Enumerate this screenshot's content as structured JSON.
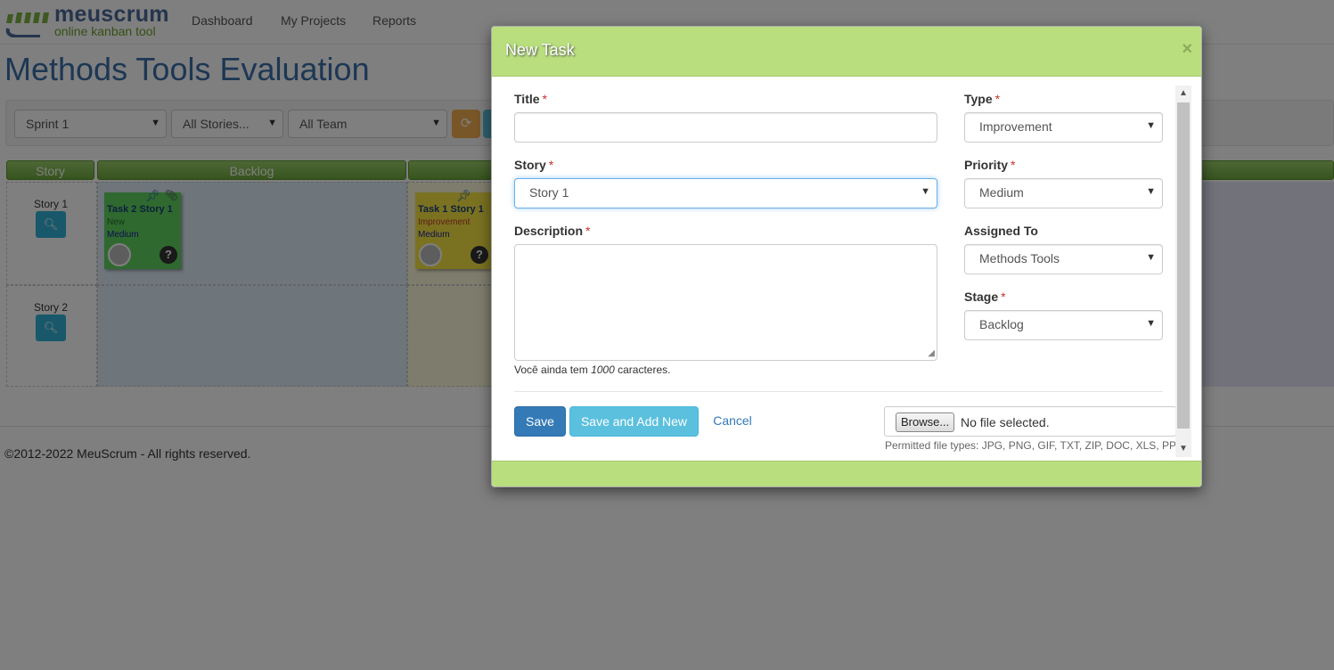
{
  "brand": {
    "name": "meuscrum",
    "tagline": "online kanban tool"
  },
  "nav": [
    {
      "label": "Dashboard"
    },
    {
      "label": "My Projects"
    },
    {
      "label": "Reports"
    }
  ],
  "page": {
    "title": "Methods Tools Evaluation"
  },
  "filters": {
    "sprint": "Sprint 1",
    "stories": "All Stories...",
    "team": "All Team"
  },
  "board": {
    "columns": [
      "Story",
      "Backlog"
    ],
    "stories": [
      {
        "label": "Story 1"
      },
      {
        "label": "Story 2"
      }
    ],
    "cards": [
      {
        "title": "Task 2 Story 1",
        "type": "New",
        "priority": "Medium",
        "color": "#5fd35f"
      },
      {
        "title": "Task 1 Story 1",
        "type": "Improvement",
        "priority": "Medium",
        "color": "#f4e542"
      }
    ]
  },
  "footer": {
    "text": "©2012-2022 MeuScrum - All rights reserved."
  },
  "modal": {
    "title": "New Task",
    "close": "×",
    "fields": {
      "title": {
        "label": "Title",
        "value": ""
      },
      "story": {
        "label": "Story",
        "value": "Story 1"
      },
      "description": {
        "label": "Description",
        "value": ""
      },
      "type": {
        "label": "Type",
        "value": "Improvement"
      },
      "priority": {
        "label": "Priority",
        "value": "Medium"
      },
      "assigned": {
        "label": "Assigned To",
        "value": "Methods Tools"
      },
      "stage": {
        "label": "Stage",
        "value": "Backlog"
      }
    },
    "required_mark": "*",
    "char_hint": {
      "prefix": "Você ainda tem",
      "count": "1000",
      "suffix": "caracteres."
    },
    "buttons": {
      "save": "Save",
      "save_add": "Save and Add New",
      "cancel": "Cancel"
    },
    "file": {
      "browse": "Browse...",
      "status": "No file selected.",
      "permitted": "Permitted file types: JPG, PNG, GIF, TXT, ZIP, DOC, XLS, PPT"
    }
  },
  "colors": {
    "modal_header": "#b8de7e",
    "primary": "#337ab7",
    "info": "#5bc0de",
    "warning": "#f0ad4e",
    "title_blue": "#3a6ea8"
  }
}
